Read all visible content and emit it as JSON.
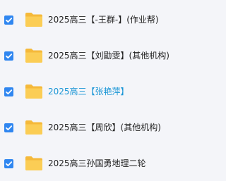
{
  "files": [
    {
      "name": "2025高三【-王群-】(作业帮)",
      "checked": true,
      "highlighted": false
    },
    {
      "name": "2025高三【刘勖雯】(其他机构)",
      "checked": true,
      "highlighted": false
    },
    {
      "name": "2025高三【张艳萍】",
      "checked": true,
      "highlighted": true
    },
    {
      "name": "2025高三【周欣】(其他机构)",
      "checked": true,
      "highlighted": false
    },
    {
      "name": "2025高三孙国勇地理二轮",
      "checked": true,
      "highlighted": false
    }
  ],
  "colors": {
    "checkbox": "#2f86f0",
    "folder": "#f7c040",
    "highlight_text": "#1a96d6",
    "text": "#1f1f1f",
    "background": "#f4f5f9"
  },
  "icons": {
    "checkbox": "checkbox-checked-icon",
    "folder": "folder-icon"
  }
}
